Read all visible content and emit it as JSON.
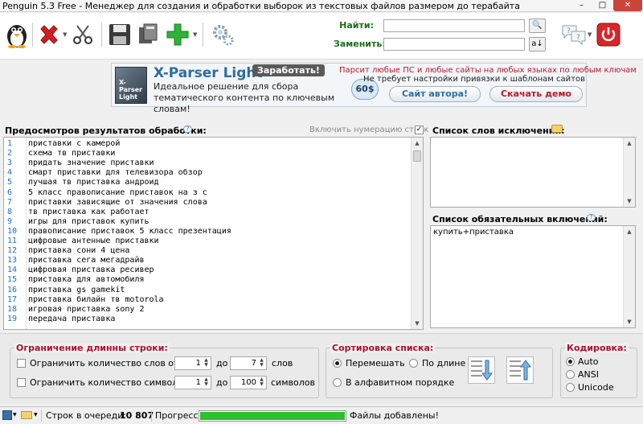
{
  "window": {
    "title": "Penguin 5.3 Free - Менеджер для создания и обработки выборок из текстовых файлов размером до терабайта",
    "min_glyph": "–",
    "max_glyph": "□",
    "close_glyph": "✕"
  },
  "toolbar": {
    "find_label": "Найти:",
    "find_value": "",
    "replace_label": "Заменить:",
    "replace_value": "",
    "find_btn_glyph": "🔍",
    "replace_btn_glyph": "a↓"
  },
  "banner": {
    "title": "X-Parser Light",
    "earn_label": "Заработать!",
    "desc_line1": "Идеальное решение для сбора",
    "desc_line2": "тематического контента по ключевым словам!",
    "price": "60$",
    "red_text": "Парсит любые ПС и любые сайты на любых языках по любым ключам",
    "black_text": "Не требует настройки привязки к шаблонам сайтов",
    "btn_site": "Сайт автора!",
    "btn_demo": "Скачать демо",
    "box_label": "X-Parser Light"
  },
  "preview": {
    "title": "Предосмотров результатов обработки:",
    "numbering_label": "Включить нумерацию строк",
    "line_numbers": [
      "1",
      "2",
      "3",
      "4",
      "5",
      "6",
      "7",
      "8",
      "9",
      "10",
      "11",
      "12",
      "13",
      "14",
      "15",
      "16",
      "17",
      "18",
      "19"
    ],
    "lines": [
      "приставки с камерой",
      "схема тв приставки",
      "придать значение приставки",
      "смарт приставки для телевизора обзор",
      "лучшая тв приставка андроид",
      "5 класс правописание приставок на з с",
      "приставки зависящие от значения слова",
      "тв приставка как работает",
      "игры для приставок купить",
      "правописание приставок 5 класс презентация",
      "цифровые антенные приставки",
      "приставка сони 4 цена",
      "приставка сега мегадрайв",
      "цифровая приставка ресивер",
      "приставка для автомобиля",
      "приставка gs gamekit",
      "приставка билайн тв motorola",
      "игровая приставка sony 2",
      "передача приставка"
    ]
  },
  "exclusions": {
    "title": "Список слов исключений:",
    "value": ""
  },
  "required": {
    "title": "Список обязательных включений:",
    "value": "купить+приставка"
  },
  "limits": {
    "title": "Ограничение длинны строки:",
    "words_label": "Ограничить количество слов от",
    "words_from": "1",
    "words_to": "7",
    "words_unit": "слов",
    "chars_label": "Ограничить количество символов от",
    "chars_from": "1",
    "chars_to": "100",
    "chars_unit": "символов",
    "to_label": "до"
  },
  "sort": {
    "title": "Сортировка списка:",
    "shuffle": "Перемешать",
    "by_length": "По длине",
    "alpha": "В алфавитном порядке"
  },
  "encoding": {
    "title": "Кодировка:",
    "options": [
      "Auto",
      "ANSI",
      "Unicode"
    ],
    "selected": "Auto"
  },
  "status": {
    "queue_label": "Строк в очереди:",
    "queue_value": "10 807",
    "progress_label": "Прогресс:",
    "progress_fraction": 1.0,
    "message": "Файлы добавлены!"
  },
  "colors": {
    "accent_red": "#a5142a",
    "link_blue": "#1e73c9",
    "progress_green": "#2ec02e",
    "label_green": "#1a6e1a"
  },
  "icons": [
    "penguin-icon",
    "delete-icon",
    "cut-icon",
    "save-icon",
    "copy-files-icon",
    "add-icon",
    "settings-gear-icon",
    "help-icon",
    "power-icon",
    "search-icon",
    "replace-icon"
  ]
}
